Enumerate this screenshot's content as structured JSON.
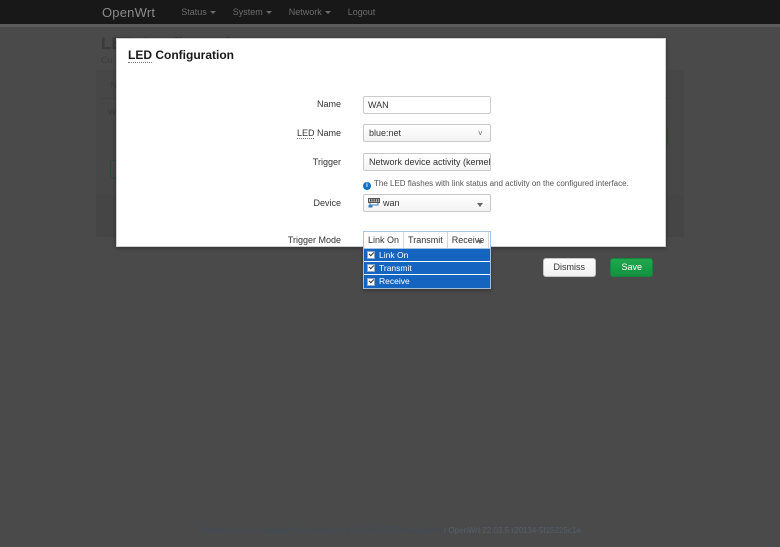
{
  "navbar": {
    "brand": "OpenWrt",
    "items": [
      {
        "label": "Status",
        "has_caret": true
      },
      {
        "label": "System",
        "has_caret": true
      },
      {
        "label": "Network",
        "has_caret": true
      },
      {
        "label": "Logout",
        "has_caret": false
      }
    ]
  },
  "background_page": {
    "title": "LED Configuration",
    "subtitle": "Cu",
    "label_name": "N",
    "value_wan": "W"
  },
  "modal": {
    "title_abbr": "LED",
    "title_rest": " Configuration",
    "fields": {
      "name": {
        "label": "Name",
        "value": "WAN",
        "placeholder": ""
      },
      "led_name": {
        "label_abbr": "LED",
        "label_rest": " Name",
        "value": "blue:net"
      },
      "trigger": {
        "label": "Trigger",
        "value": "Network device activity (kernel",
        "help": "The LED flashes with link status and activity on the configured interface."
      },
      "device": {
        "label": "Device",
        "value": "wan",
        "icon": "ethernet-port-icon"
      },
      "trigger_mode": {
        "label": "Trigger Mode",
        "chips": [
          "Link On",
          "Transmit",
          "Receive"
        ],
        "options": [
          {
            "label": "Link On",
            "checked": true
          },
          {
            "label": "Transmit",
            "checked": true
          },
          {
            "label": "Receive",
            "checked": true
          }
        ]
      }
    },
    "buttons": {
      "dismiss": "Dismiss",
      "save": "Save"
    }
  },
  "footer": {
    "powered_prefix": "Powered by LuCI openwrt-22.03 branch (git-23.093.57104-ce20b4a)",
    "powered_suffix": " / OpenWrt 22.03.5 r20134-5f15225c1e"
  },
  "colors": {
    "navbar_bg": "#181818",
    "page_dim": "#4a4a4a",
    "modal_bg": "#ffffff",
    "dropdown_selected": "#1565c0",
    "save_green": "#17a24a",
    "info_blue": "#1072c6"
  }
}
